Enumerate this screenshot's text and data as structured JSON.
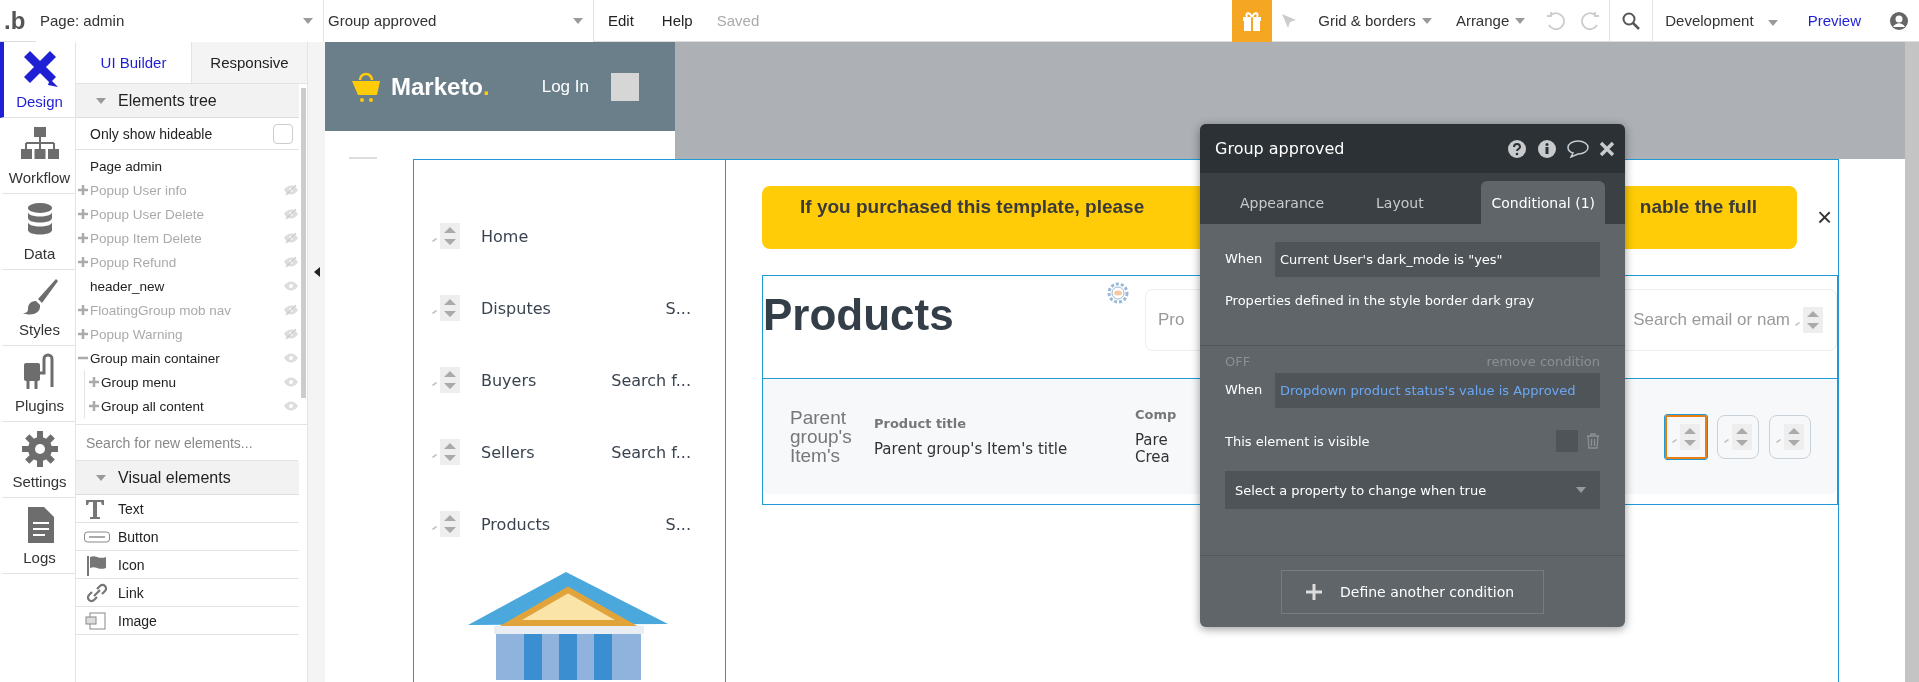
{
  "top_bar": {
    "logo": ".b",
    "page_selector": "Page: admin",
    "element_selector": "Group approved",
    "menu": [
      "Edit",
      "Help"
    ],
    "status": "Saved",
    "tools": [
      "Grid & borders",
      "Arrange"
    ],
    "environment": "Development",
    "preview": "Preview"
  },
  "rail": [
    {
      "kind": "design",
      "label": "Design",
      "selected": true
    },
    {
      "kind": "workflow",
      "label": "Workflow",
      "selected": false
    },
    {
      "kind": "data",
      "label": "Data",
      "selected": false
    },
    {
      "kind": "styles",
      "label": "Styles",
      "selected": false
    },
    {
      "kind": "plugins",
      "label": "Plugins",
      "selected": false
    },
    {
      "kind": "settings",
      "label": "Settings",
      "selected": false
    },
    {
      "kind": "logs",
      "label": "Logs",
      "selected": false
    }
  ],
  "panel": {
    "tabs": [
      {
        "label": "UI Builder",
        "selected": true
      },
      {
        "label": "Responsive",
        "selected": false
      }
    ],
    "tree_header": "Elements tree",
    "only_show_hideable": {
      "label": "Only show hideable",
      "checked": false
    },
    "tree": [
      {
        "label": "Page admin",
        "kind": "page"
      },
      {
        "label": "Popup User info",
        "kind": "element",
        "expanded": false,
        "hidden": true
      },
      {
        "label": "Popup User Delete",
        "kind": "element",
        "expanded": false,
        "hidden": true
      },
      {
        "label": "Popup Item Delete",
        "kind": "element",
        "expanded": false,
        "hidden": true
      },
      {
        "label": "Popup Refund",
        "kind": "element",
        "expanded": false,
        "hidden": true
      },
      {
        "label": "header_new",
        "kind": "element",
        "hidden": false
      },
      {
        "label": "FloatingGroup mob nav",
        "kind": "element",
        "expanded": false,
        "hidden": true
      },
      {
        "label": "Popup Warning",
        "kind": "element",
        "expanded": false,
        "hidden": true
      },
      {
        "label": "Group main container",
        "kind": "element",
        "expanded": true,
        "hidden": false,
        "children": [
          {
            "label": "Group menu",
            "kind": "element",
            "expanded": false,
            "hidden": false
          },
          {
            "label": "Group all content",
            "kind": "element",
            "expanded": false,
            "hidden": false
          }
        ]
      }
    ],
    "search_placeholder": "Search for new elements...",
    "visual_header": "Visual elements",
    "elements": [
      {
        "kind": "text",
        "label": "Text"
      },
      {
        "kind": "button",
        "label": "Button"
      },
      {
        "kind": "icon",
        "label": "Icon"
      },
      {
        "kind": "link",
        "label": "Link"
      },
      {
        "kind": "image",
        "label": "Image"
      }
    ]
  },
  "canvas": {
    "header": {
      "logo": "Marketo",
      "logo_dot": ".",
      "login": "Log In"
    },
    "menu": [
      {
        "label": "Home"
      },
      {
        "label": "Disputes",
        "search": "S..."
      },
      {
        "label": "Buyers",
        "search": "Search f..."
      },
      {
        "label": "Sellers",
        "search": "Search f..."
      },
      {
        "label": "Products",
        "search": "S..."
      }
    ],
    "banner": {
      "text_left": "If you purchased this template, please",
      "text_right": "nable the full",
      "close": "×"
    },
    "products": {
      "heading": "Products",
      "search_left": "Pro",
      "search_right": "Search email or nam",
      "row": {
        "image_text": "Parent group's Item's",
        "columns": [
          {
            "header": "Product title",
            "value": "Parent group's Item's title"
          },
          {
            "header": "Comp",
            "value": "Pare\nCrea"
          }
        ],
        "actions": [
          {
            "selected": true
          },
          {
            "selected": false
          },
          {
            "selected": false
          }
        ]
      }
    }
  },
  "popup": {
    "title": "Group approved",
    "tabs": [
      {
        "label": "Appearance",
        "selected": false
      },
      {
        "label": "Layout",
        "selected": false
      },
      {
        "label": "Conditional (1)",
        "selected": true
      }
    ],
    "conditions": [
      {
        "when": "When",
        "expression": "Current User's dark_mode is \"yes\"",
        "note": "Properties defined in the style border dark gray"
      },
      {
        "status": "OFF",
        "remove": "remove condition",
        "when": "When",
        "expression": "Dropdown product status's value is Approved",
        "property": {
          "label": "This element is visible",
          "checked": false
        },
        "select_placeholder": "Select a property to change when true"
      }
    ],
    "add_button": "Define another condition"
  }
}
